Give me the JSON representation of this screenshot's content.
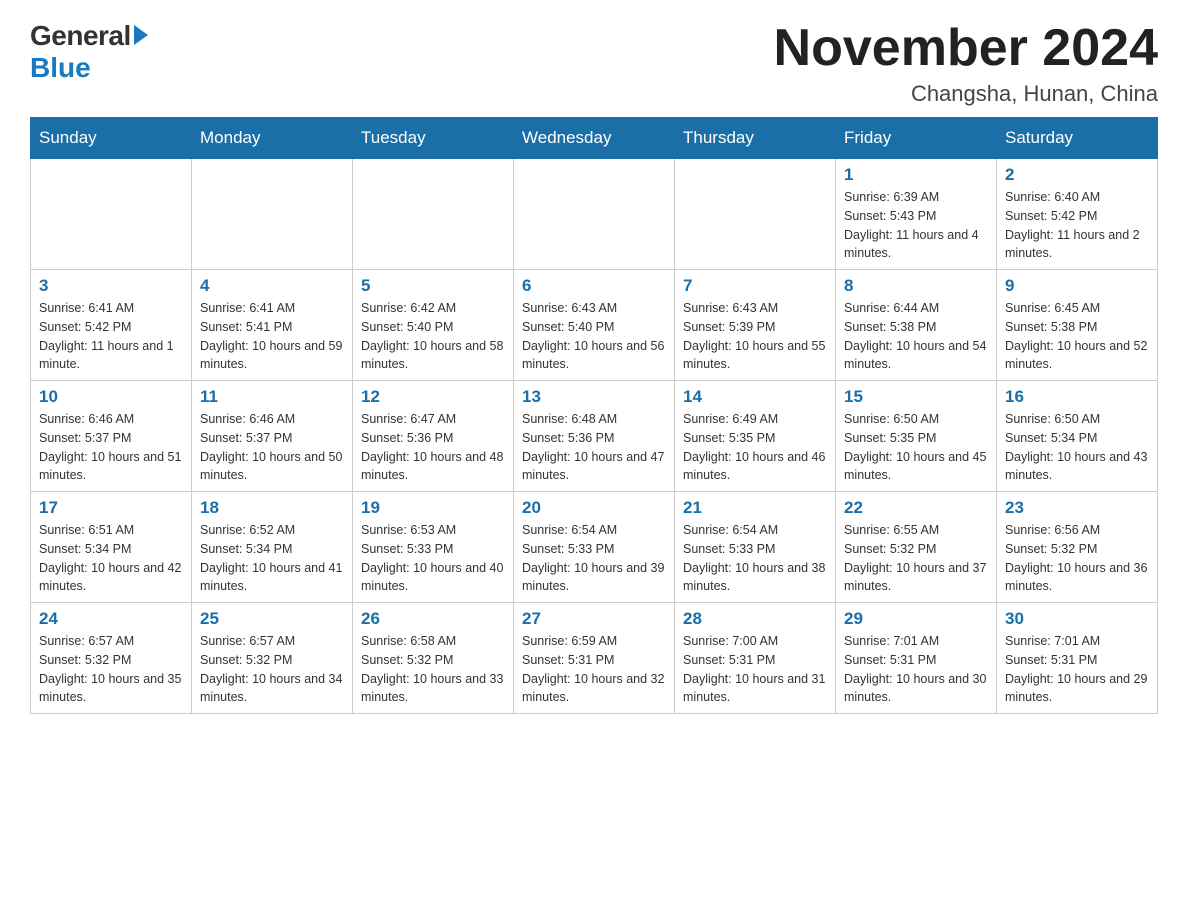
{
  "logo": {
    "general": "General",
    "blue": "Blue"
  },
  "title": "November 2024",
  "subtitle": "Changsha, Hunan, China",
  "weekdays": [
    "Sunday",
    "Monday",
    "Tuesday",
    "Wednesday",
    "Thursday",
    "Friday",
    "Saturday"
  ],
  "weeks": [
    [
      {
        "day": "",
        "info": ""
      },
      {
        "day": "",
        "info": ""
      },
      {
        "day": "",
        "info": ""
      },
      {
        "day": "",
        "info": ""
      },
      {
        "day": "",
        "info": ""
      },
      {
        "day": "1",
        "info": "Sunrise: 6:39 AM\nSunset: 5:43 PM\nDaylight: 11 hours and 4 minutes."
      },
      {
        "day": "2",
        "info": "Sunrise: 6:40 AM\nSunset: 5:42 PM\nDaylight: 11 hours and 2 minutes."
      }
    ],
    [
      {
        "day": "3",
        "info": "Sunrise: 6:41 AM\nSunset: 5:42 PM\nDaylight: 11 hours and 1 minute."
      },
      {
        "day": "4",
        "info": "Sunrise: 6:41 AM\nSunset: 5:41 PM\nDaylight: 10 hours and 59 minutes."
      },
      {
        "day": "5",
        "info": "Sunrise: 6:42 AM\nSunset: 5:40 PM\nDaylight: 10 hours and 58 minutes."
      },
      {
        "day": "6",
        "info": "Sunrise: 6:43 AM\nSunset: 5:40 PM\nDaylight: 10 hours and 56 minutes."
      },
      {
        "day": "7",
        "info": "Sunrise: 6:43 AM\nSunset: 5:39 PM\nDaylight: 10 hours and 55 minutes."
      },
      {
        "day": "8",
        "info": "Sunrise: 6:44 AM\nSunset: 5:38 PM\nDaylight: 10 hours and 54 minutes."
      },
      {
        "day": "9",
        "info": "Sunrise: 6:45 AM\nSunset: 5:38 PM\nDaylight: 10 hours and 52 minutes."
      }
    ],
    [
      {
        "day": "10",
        "info": "Sunrise: 6:46 AM\nSunset: 5:37 PM\nDaylight: 10 hours and 51 minutes."
      },
      {
        "day": "11",
        "info": "Sunrise: 6:46 AM\nSunset: 5:37 PM\nDaylight: 10 hours and 50 minutes."
      },
      {
        "day": "12",
        "info": "Sunrise: 6:47 AM\nSunset: 5:36 PM\nDaylight: 10 hours and 48 minutes."
      },
      {
        "day": "13",
        "info": "Sunrise: 6:48 AM\nSunset: 5:36 PM\nDaylight: 10 hours and 47 minutes."
      },
      {
        "day": "14",
        "info": "Sunrise: 6:49 AM\nSunset: 5:35 PM\nDaylight: 10 hours and 46 minutes."
      },
      {
        "day": "15",
        "info": "Sunrise: 6:50 AM\nSunset: 5:35 PM\nDaylight: 10 hours and 45 minutes."
      },
      {
        "day": "16",
        "info": "Sunrise: 6:50 AM\nSunset: 5:34 PM\nDaylight: 10 hours and 43 minutes."
      }
    ],
    [
      {
        "day": "17",
        "info": "Sunrise: 6:51 AM\nSunset: 5:34 PM\nDaylight: 10 hours and 42 minutes."
      },
      {
        "day": "18",
        "info": "Sunrise: 6:52 AM\nSunset: 5:34 PM\nDaylight: 10 hours and 41 minutes."
      },
      {
        "day": "19",
        "info": "Sunrise: 6:53 AM\nSunset: 5:33 PM\nDaylight: 10 hours and 40 minutes."
      },
      {
        "day": "20",
        "info": "Sunrise: 6:54 AM\nSunset: 5:33 PM\nDaylight: 10 hours and 39 minutes."
      },
      {
        "day": "21",
        "info": "Sunrise: 6:54 AM\nSunset: 5:33 PM\nDaylight: 10 hours and 38 minutes."
      },
      {
        "day": "22",
        "info": "Sunrise: 6:55 AM\nSunset: 5:32 PM\nDaylight: 10 hours and 37 minutes."
      },
      {
        "day": "23",
        "info": "Sunrise: 6:56 AM\nSunset: 5:32 PM\nDaylight: 10 hours and 36 minutes."
      }
    ],
    [
      {
        "day": "24",
        "info": "Sunrise: 6:57 AM\nSunset: 5:32 PM\nDaylight: 10 hours and 35 minutes."
      },
      {
        "day": "25",
        "info": "Sunrise: 6:57 AM\nSunset: 5:32 PM\nDaylight: 10 hours and 34 minutes."
      },
      {
        "day": "26",
        "info": "Sunrise: 6:58 AM\nSunset: 5:32 PM\nDaylight: 10 hours and 33 minutes."
      },
      {
        "day": "27",
        "info": "Sunrise: 6:59 AM\nSunset: 5:31 PM\nDaylight: 10 hours and 32 minutes."
      },
      {
        "day": "28",
        "info": "Sunrise: 7:00 AM\nSunset: 5:31 PM\nDaylight: 10 hours and 31 minutes."
      },
      {
        "day": "29",
        "info": "Sunrise: 7:01 AM\nSunset: 5:31 PM\nDaylight: 10 hours and 30 minutes."
      },
      {
        "day": "30",
        "info": "Sunrise: 7:01 AM\nSunset: 5:31 PM\nDaylight: 10 hours and 29 minutes."
      }
    ]
  ]
}
